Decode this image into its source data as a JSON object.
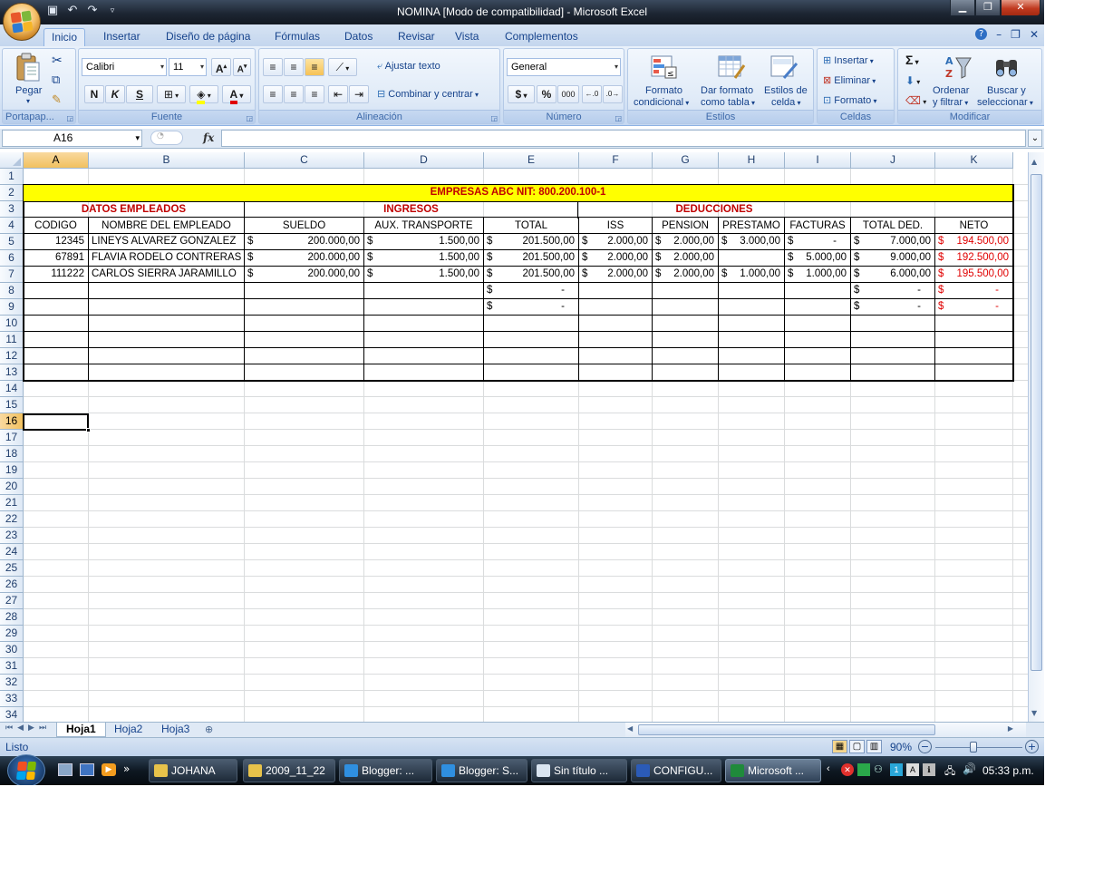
{
  "window": {
    "title": "NOMINA  [Modo de compatibilidad] - Microsoft Excel"
  },
  "ribbon": {
    "tabs": [
      "Inicio",
      "Insertar",
      "Diseño de página",
      "Fórmulas",
      "Datos",
      "Revisar",
      "Vista",
      "Complementos"
    ],
    "clipboard": {
      "paste": "Pegar",
      "label": "Portapap..."
    },
    "font": {
      "name": "Calibri",
      "size": "11",
      "bold": "N",
      "italic": "K",
      "underline": "S",
      "label": "Fuente"
    },
    "alignment": {
      "wrap": "Ajustar texto",
      "merge": "Combinar y centrar",
      "label": "Alineación"
    },
    "number": {
      "format": "General",
      "currency": "$",
      "percent": "%",
      "thousands": "000",
      "label": "Número"
    },
    "styles": {
      "cond1": "Formato",
      "cond2": "condicional",
      "table1": "Dar formato",
      "table2": "como tabla",
      "cell1": "Estilos de",
      "cell2": "celda",
      "label": "Estilos"
    },
    "cells": {
      "insert": "Insertar",
      "delete": "Eliminar",
      "format": "Formato",
      "label": "Celdas"
    },
    "editing": {
      "sort1": "Ordenar",
      "sort2": "y filtrar",
      "find1": "Buscar y",
      "find2": "seleccionar",
      "label": "Modificar"
    }
  },
  "formula_bar": {
    "name_box": "A16",
    "fx": "fx",
    "formula": ""
  },
  "columns": [
    "A",
    "B",
    "C",
    "D",
    "E",
    "F",
    "G",
    "H",
    "I",
    "J",
    "K"
  ],
  "rows": [
    "1",
    "2",
    "3",
    "4",
    "5",
    "6",
    "7",
    "8",
    "9",
    "10",
    "11",
    "12",
    "13",
    "14",
    "15",
    "16",
    "17",
    "18",
    "19",
    "20",
    "21",
    "22",
    "23",
    "24",
    "25",
    "26",
    "27",
    "28",
    "29",
    "30",
    "31",
    "32",
    "33",
    "34"
  ],
  "sheet": {
    "title": "EMPRESAS ABC NIT: 800.200.100-1",
    "sections": [
      "DATOS EMPLEADOS",
      "INGRESOS",
      "DEDUCCIONES"
    ],
    "headers": [
      "CODIGO",
      "NOMBRE DEL EMPLEADO",
      "SUELDO",
      "AUX. TRANSPORTE",
      "TOTAL",
      "ISS",
      "PENSION",
      "PRESTAMO",
      "FACTURAS",
      "TOTAL DED.",
      "NETO"
    ],
    "employees": [
      {
        "codigo": "12345",
        "nombre": "LINEYS ALVAREZ GONZALEZ",
        "sueldo": "200.000,00",
        "aux": "1.500,00",
        "total": "201.500,00",
        "iss": "2.000,00",
        "pension": "2.000,00",
        "prestamo": "3.000,00",
        "facturas": "-",
        "total_ded": "7.000,00",
        "neto": "194.500,00"
      },
      {
        "codigo": "67891",
        "nombre": "FLAVIA RODELO CONTRERAS",
        "sueldo": "200.000,00",
        "aux": "1.500,00",
        "total": "201.500,00",
        "iss": "2.000,00",
        "pension": "2.000,00",
        "prestamo": "",
        "facturas": "5.000,00",
        "total_ded": "9.000,00",
        "neto": "192.500,00"
      },
      {
        "codigo": "111222",
        "nombre": "CARLOS SIERRA JARAMILLO",
        "sueldo": "200.000,00",
        "aux": "1.500,00",
        "total": "201.500,00",
        "iss": "2.000,00",
        "pension": "2.000,00",
        "prestamo": "1.000,00",
        "facturas": "1.000,00",
        "total_ded": "6.000,00",
        "neto": "195.500,00"
      }
    ],
    "empty_rows": [
      {
        "total": "-",
        "total_ded": "-",
        "neto": "-"
      },
      {
        "total": "-",
        "total_ded": "-",
        "neto": "-"
      }
    ],
    "currency": "$"
  },
  "sheet_tabs": [
    "Hoja1",
    "Hoja2",
    "Hoja3"
  ],
  "status": {
    "text": "Listo",
    "zoom": "90%"
  },
  "taskbar": {
    "items": [
      "JOHANA",
      "2009_11_22",
      "Blogger: ...",
      "Blogger: S...",
      "Sin título ...",
      "CONFIGU...",
      "Microsoft ..."
    ],
    "clock": "05:33 p.m."
  },
  "colors": {
    "title_fill": "#ffff00",
    "section_text": "#c00000",
    "neto_text": "#e00000"
  }
}
